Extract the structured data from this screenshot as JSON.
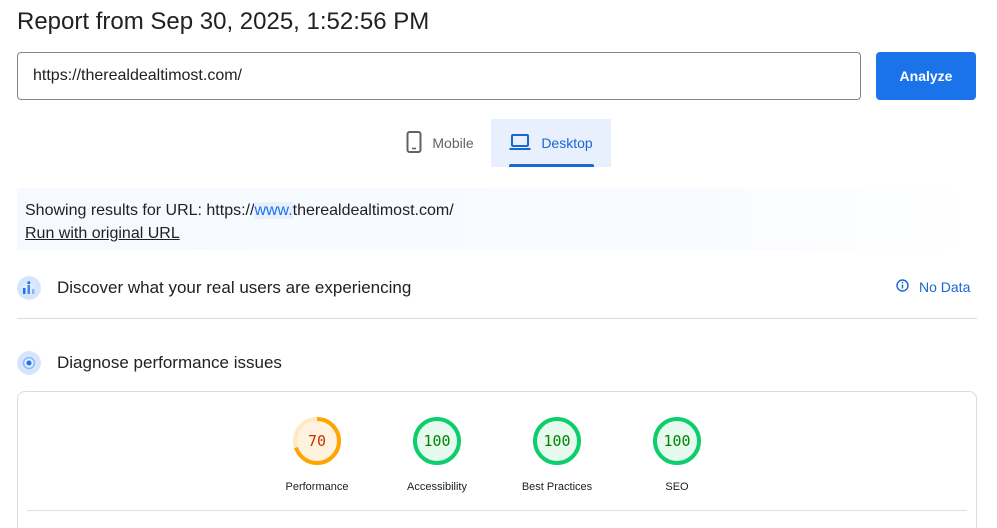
{
  "report": {
    "title": "Report from Sep 30, 2025, 1:52:56 PM"
  },
  "url_bar": {
    "value": "https://therealdealtimost.com/",
    "analyze_label": "Analyze"
  },
  "tabs": [
    {
      "label": "Mobile",
      "icon": "smartphone-icon",
      "selected": false
    },
    {
      "label": "Desktop",
      "icon": "laptop-icon",
      "selected": true
    }
  ],
  "notice": {
    "prefix": "Showing results for URL: https://",
    "highlight": "www.",
    "suffix": "therealdealtimost.com/",
    "run_link": "Run with original URL"
  },
  "field_data": {
    "title": "Discover what your real users are experiencing",
    "status": "No Data",
    "status_icon": "info-icon",
    "icon": "users-chart-icon"
  },
  "lab_data": {
    "title": "Diagnose performance issues",
    "icon": "performance-icon"
  },
  "colors": {
    "accent": "#1a73e8",
    "pass": "#0cce6b",
    "pass_text": "#008800",
    "average": "#ffa400",
    "average_text": "#c33300"
  },
  "scores": [
    {
      "label": "Performance",
      "value": "70",
      "score": 70,
      "rating": "average"
    },
    {
      "label": "Accessibility",
      "value": "100",
      "score": 100,
      "rating": "pass"
    },
    {
      "label": "Best Practices",
      "value": "100",
      "score": 100,
      "rating": "pass"
    },
    {
      "label": "SEO",
      "value": "100",
      "score": 100,
      "rating": "pass"
    }
  ]
}
